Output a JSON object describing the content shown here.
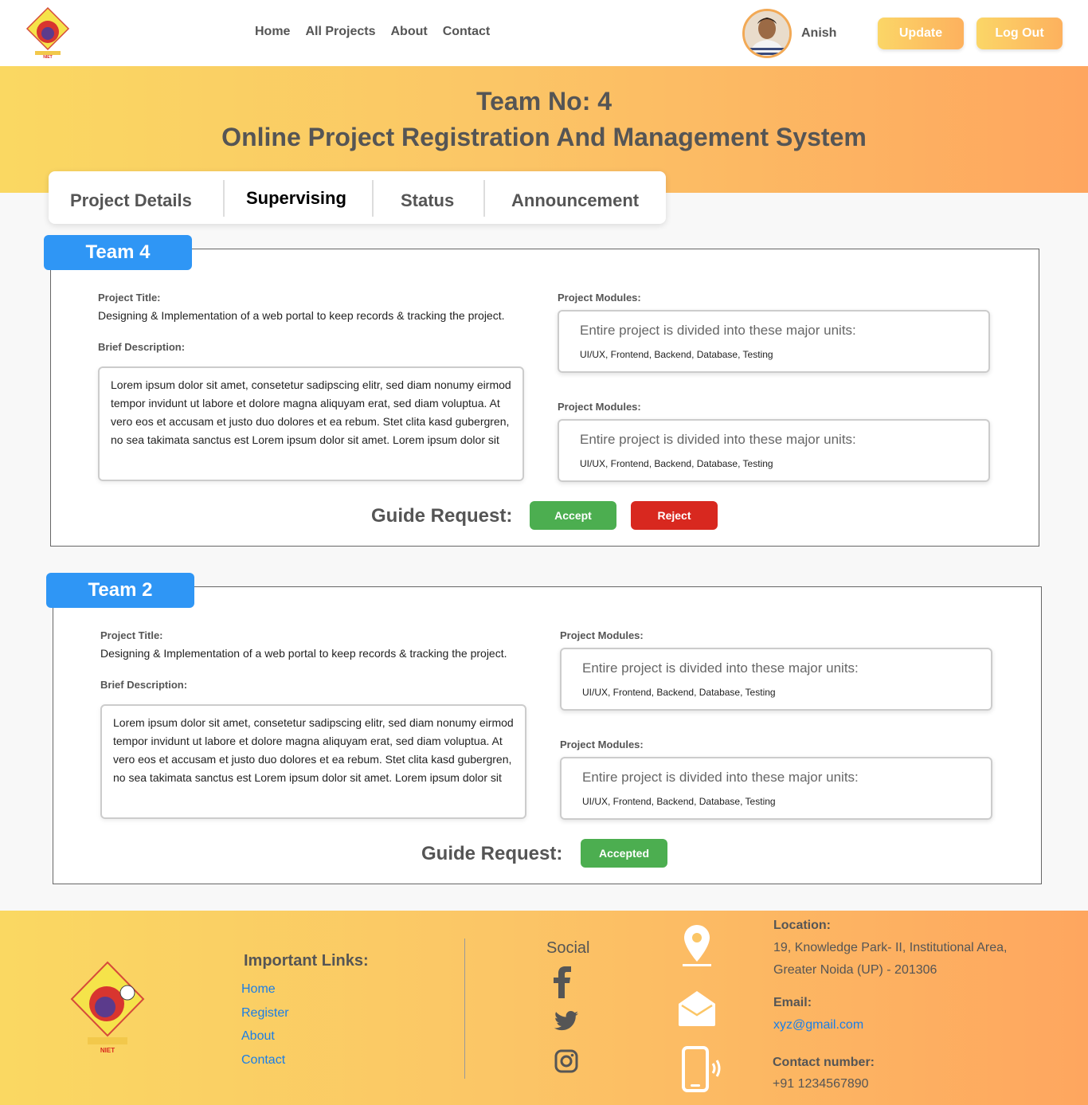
{
  "nav": {
    "links": [
      "Home",
      "All Projects",
      "About",
      "Contact"
    ],
    "user_name": "Anish",
    "update_label": "Update",
    "logout_label": "Log Out"
  },
  "hero": {
    "team": "Team No: 4",
    "title": "Online Project Registration And Management System"
  },
  "tabs": [
    "Project Details",
    "Supervising",
    "Status",
    "Announcement"
  ],
  "teams": [
    {
      "badge": "Team 4",
      "project_title_label": "Project Title:",
      "project_title": "Designing & Implementation of a web portal to keep records & tracking the project.",
      "brief_label": "Brief Description:",
      "brief": "Lorem ipsum dolor sit amet, consetetur sadipscing elitr, sed diam nonumy eirmod tempor invidunt ut labore et dolore magna aliquyam erat, sed diam voluptua. At vero eos et accusam et justo duo dolores et ea rebum. Stet clita kasd gubergren, no sea takimata sanctus est Lorem ipsum dolor sit amet. Lorem ipsum dolor sit",
      "modules": [
        {
          "label": "Project Modules:",
          "heading": "Entire project is divided into these major units:",
          "units": "UI/UX, Frontend, Backend, Database, Testing"
        },
        {
          "label": "Project Modules:",
          "heading": "Entire project is divided into these major units:",
          "units": "UI/UX, Frontend, Backend, Database, Testing"
        }
      ],
      "guide_label": "Guide Request:",
      "accept_label": "Accept",
      "reject_label": "Reject"
    },
    {
      "badge": "Team 2",
      "project_title_label": "Project Title:",
      "project_title": "Designing & Implementation of a web portal to keep records & tracking the project.",
      "brief_label": "Brief Description:",
      "brief": "Lorem ipsum dolor sit amet, consetetur sadipscing elitr, sed diam nonumy eirmod tempor invidunt ut labore et dolore magna aliquyam erat, sed diam voluptua. At vero eos et accusam et justo duo dolores et ea rebum. Stet clita kasd gubergren, no sea takimata sanctus est Lorem ipsum dolor sit amet. Lorem ipsum dolor sit",
      "modules": [
        {
          "label": "Project Modules:",
          "heading": "Entire project is divided into these major units:",
          "units": "UI/UX, Frontend, Backend, Database, Testing"
        },
        {
          "label": "Project Modules:",
          "heading": "Entire project is divided into these major units:",
          "units": "UI/UX, Frontend, Backend, Database, Testing"
        }
      ],
      "guide_label": "Guide Request:",
      "accepted_label": "Accepted"
    }
  ],
  "footer": {
    "logo_text": "NIET",
    "important_links_label": "Important Links:",
    "links": [
      "Home",
      "Register",
      "About",
      "Contact"
    ],
    "social_label": "Social",
    "social_icons": [
      "facebook-icon",
      "twitter-icon",
      "instagram-icon"
    ],
    "location_label": "Location:",
    "location_line1": "19, Knowledge Park- II, Institutional Area,",
    "location_line2": "Greater Noida (UP) - 201306",
    "email_label": "Email:",
    "email": "xyz@gmail.com",
    "contact_label": "Contact number:",
    "contact": "+91 1234567890"
  },
  "colors": {
    "accent_blue": "#2f96f5",
    "accept_green": "#4cae50",
    "reject_red": "#d8281f",
    "gradient_start": "#fad862",
    "gradient_end": "#fea65f"
  }
}
